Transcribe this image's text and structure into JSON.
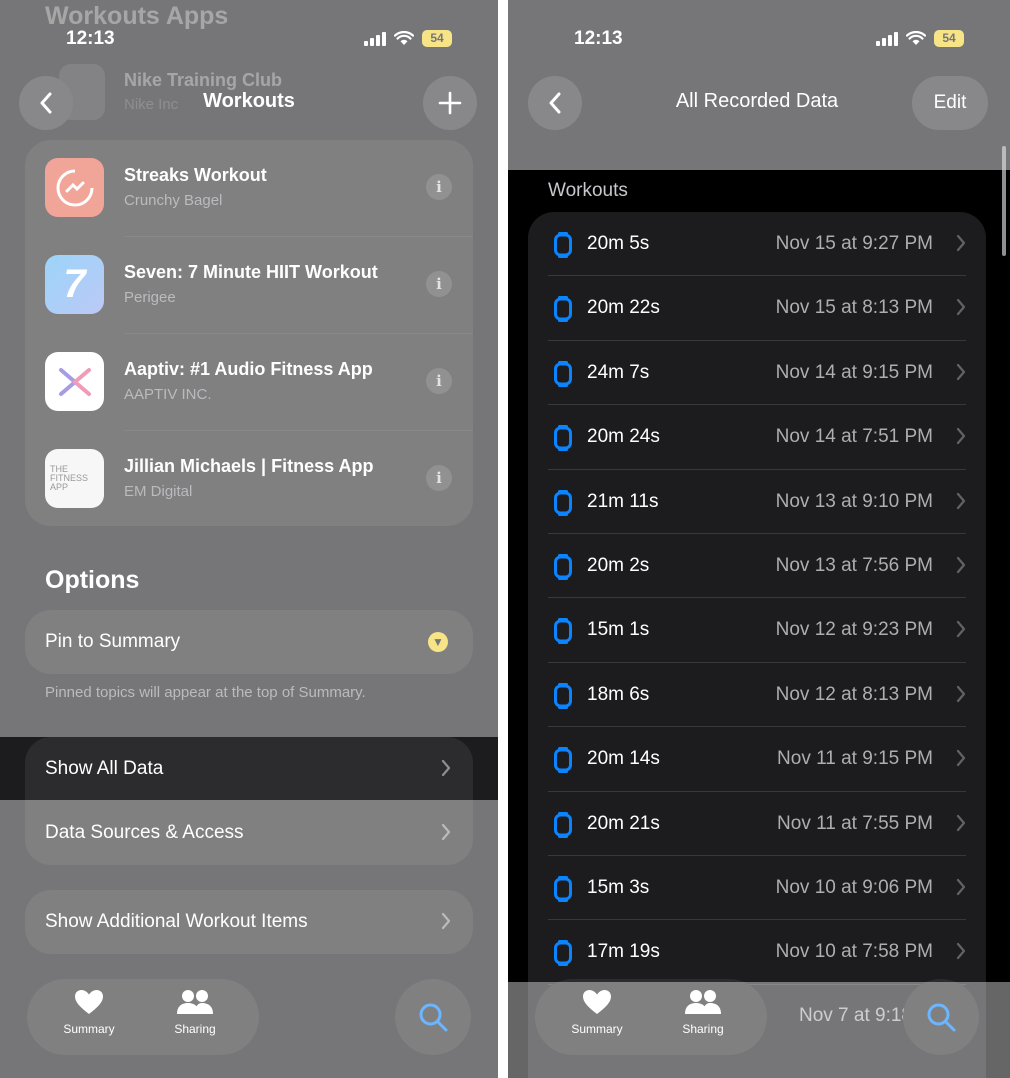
{
  "left": {
    "status_time": "12:13",
    "battery": "54",
    "ghost_heading": "Workouts Apps",
    "ghost_app": "Nike Training Club",
    "ghost_dev": "Nike Inc",
    "nav_title": "Workouts",
    "apps": [
      {
        "name": "Streaks Workout",
        "developer": "Crunchy Bagel",
        "icon": "streaks-icon",
        "color": "#e86a55"
      },
      {
        "name": "Seven: 7 Minute HIIT Workout",
        "developer": "Perigee",
        "icon": "seven-icon",
        "color": "#6fb6f0",
        "glyph": "7"
      },
      {
        "name": "Aaptiv: #1 Audio Fitness App",
        "developer": "AAPTIV INC.",
        "icon": "aaptiv-icon",
        "color": "#ffffff"
      },
      {
        "name": "Jillian Michaels | Fitness App",
        "developer": "EM Digital",
        "icon": "fitness-app-icon",
        "color": "#f2f2f2",
        "glyph_lines": [
          "THE",
          "FITNESS",
          "APP"
        ]
      }
    ],
    "info_glyph": "i",
    "options_title": "Options",
    "pin_label": "Pin to Summary",
    "pin_note": "Pinned topics will appear at the top of Summary.",
    "show_all_data": "Show All Data",
    "data_sources": "Data Sources & Access",
    "additional_items": "Show Additional Workout Items",
    "tabs": [
      {
        "label": "Summary",
        "icon": "heart-icon"
      },
      {
        "label": "Sharing",
        "icon": "people-icon"
      }
    ]
  },
  "right": {
    "status_time": "12:13",
    "battery": "54",
    "nav_title": "All Recorded Data",
    "edit_label": "Edit",
    "group_title": "Workouts",
    "workouts": [
      {
        "duration": "20m 5s",
        "date": "Nov 15 at 9:27 PM"
      },
      {
        "duration": "20m 22s",
        "date": "Nov 15 at 8:13 PM"
      },
      {
        "duration": "24m 7s",
        "date": "Nov 14 at 9:15 PM"
      },
      {
        "duration": "20m 24s",
        "date": "Nov 14 at 7:51 PM"
      },
      {
        "duration": "21m 11s",
        "date": "Nov 13 at 9:10 PM"
      },
      {
        "duration": "20m 2s",
        "date": "Nov 13 at 7:56 PM"
      },
      {
        "duration": "15m 1s",
        "date": "Nov 12 at 9:23 PM"
      },
      {
        "duration": "18m 6s",
        "date": "Nov 12 at 8:13 PM"
      },
      {
        "duration": "20m 14s",
        "date": "Nov 11 at 9:15 PM"
      },
      {
        "duration": "20m 21s",
        "date": "Nov 11 at 7:55 PM"
      },
      {
        "duration": "15m 3s",
        "date": "Nov 10 at 9:06 PM"
      },
      {
        "duration": "17m 19s",
        "date": "Nov 10 at 7:58 PM"
      }
    ],
    "hidden_row_date": "Nov 7 at 9:18",
    "tabs": [
      {
        "label": "Summary",
        "icon": "heart-icon"
      },
      {
        "label": "Sharing",
        "icon": "people-icon"
      }
    ]
  },
  "colors": {
    "accent_blue": "#0a84ff",
    "battery_yellow": "#f2d336"
  }
}
